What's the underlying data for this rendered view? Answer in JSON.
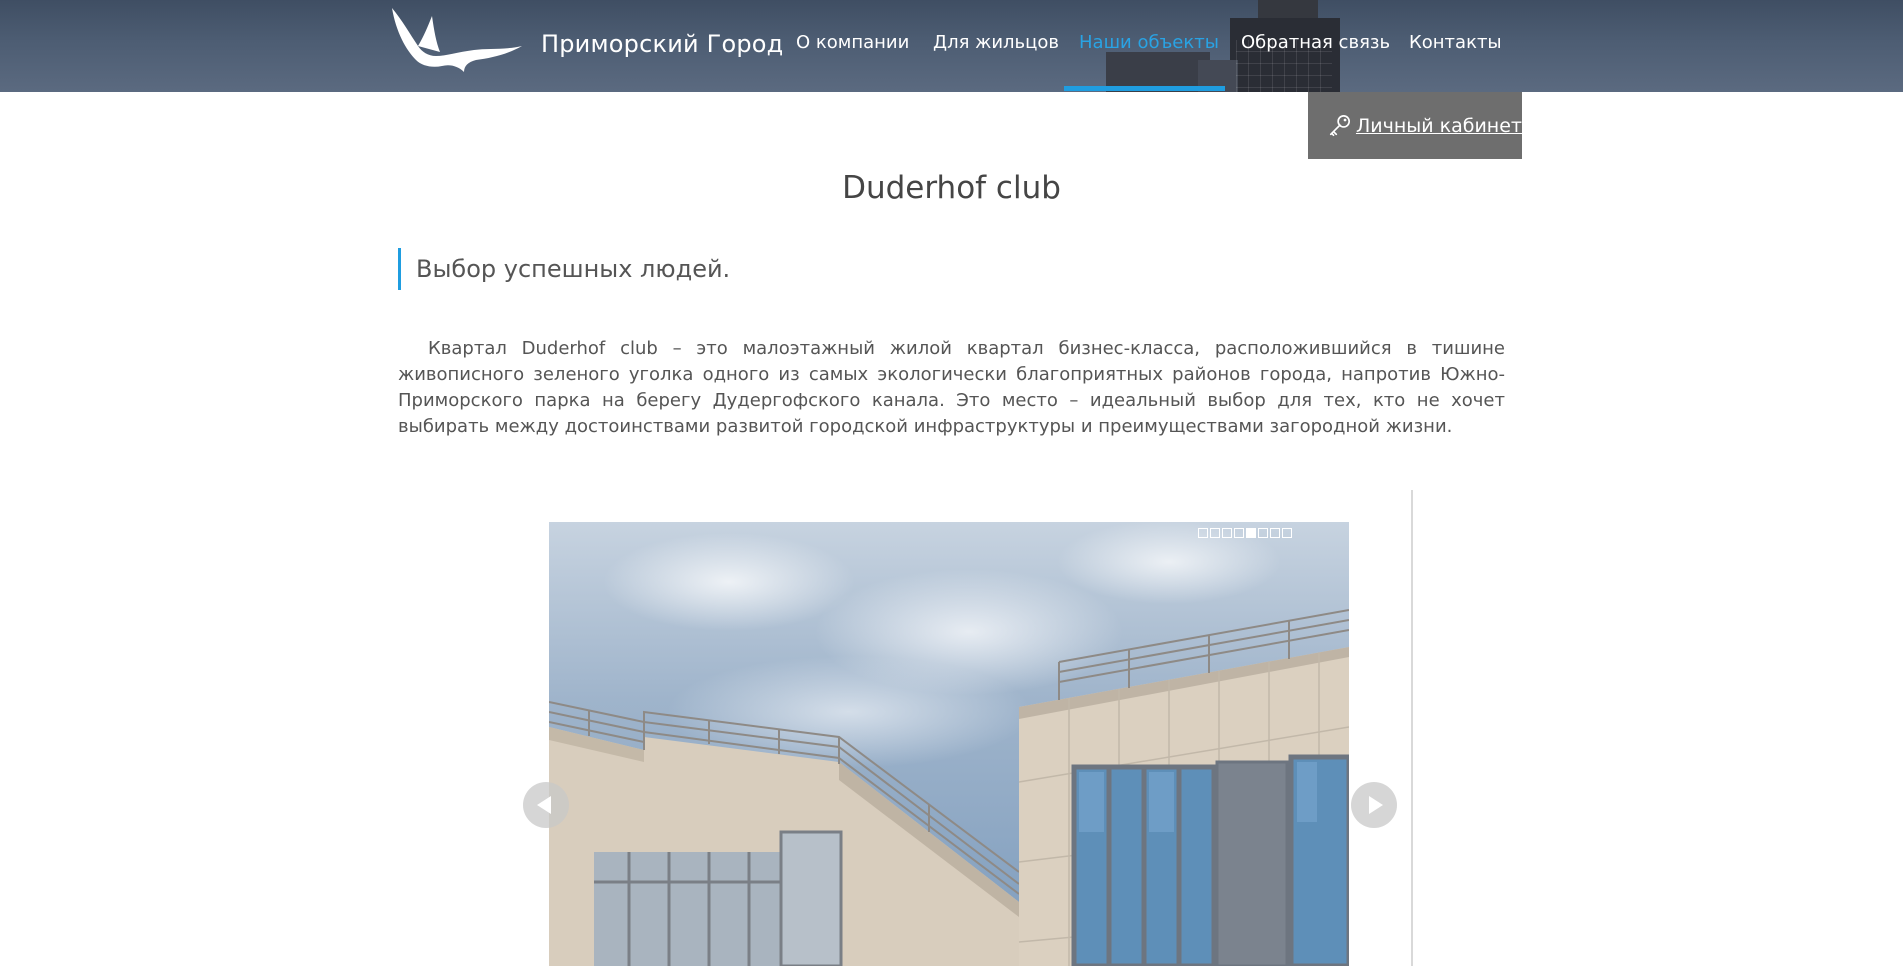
{
  "header": {
    "brand": "Приморский Город",
    "nav": [
      {
        "label": "О компании",
        "active": false
      },
      {
        "label": "Для жильцов",
        "active": false
      },
      {
        "label": "Наши объекты",
        "active": true
      },
      {
        "label": "Обратная связь",
        "active": false
      },
      {
        "label": "Контакты",
        "active": false
      }
    ],
    "cabinet_label": "Личный кабинет",
    "cabinet_icon": "key-icon",
    "logo_icon": "seagull-logo"
  },
  "main": {
    "title": "Duderhof club",
    "quote": "Выбор успешных людей.",
    "description": "Квартал Duderhof club – это малоэтажный жилой квартал бизнес-класса, расположившийся в тишине живописного зеленого уголка одного из самых экологически благоприятных районов города, напротив Южно-Приморского парка на берегу Дудергофского канала. Это место – идеальный выбор для тех, кто не хочет выбирать между достоинствами развитой городской инфраструктуры и преимуществами загородной жизни."
  },
  "slider": {
    "slide_count": 8,
    "active_index": 4,
    "prev_icon": "arrow-left-icon",
    "next_icon": "arrow-right-icon"
  },
  "colors": {
    "accent": "#1f9de0",
    "header_bg": "#4b5a70",
    "cabinet_bg": "#6e6e6e",
    "text": "#555555"
  }
}
